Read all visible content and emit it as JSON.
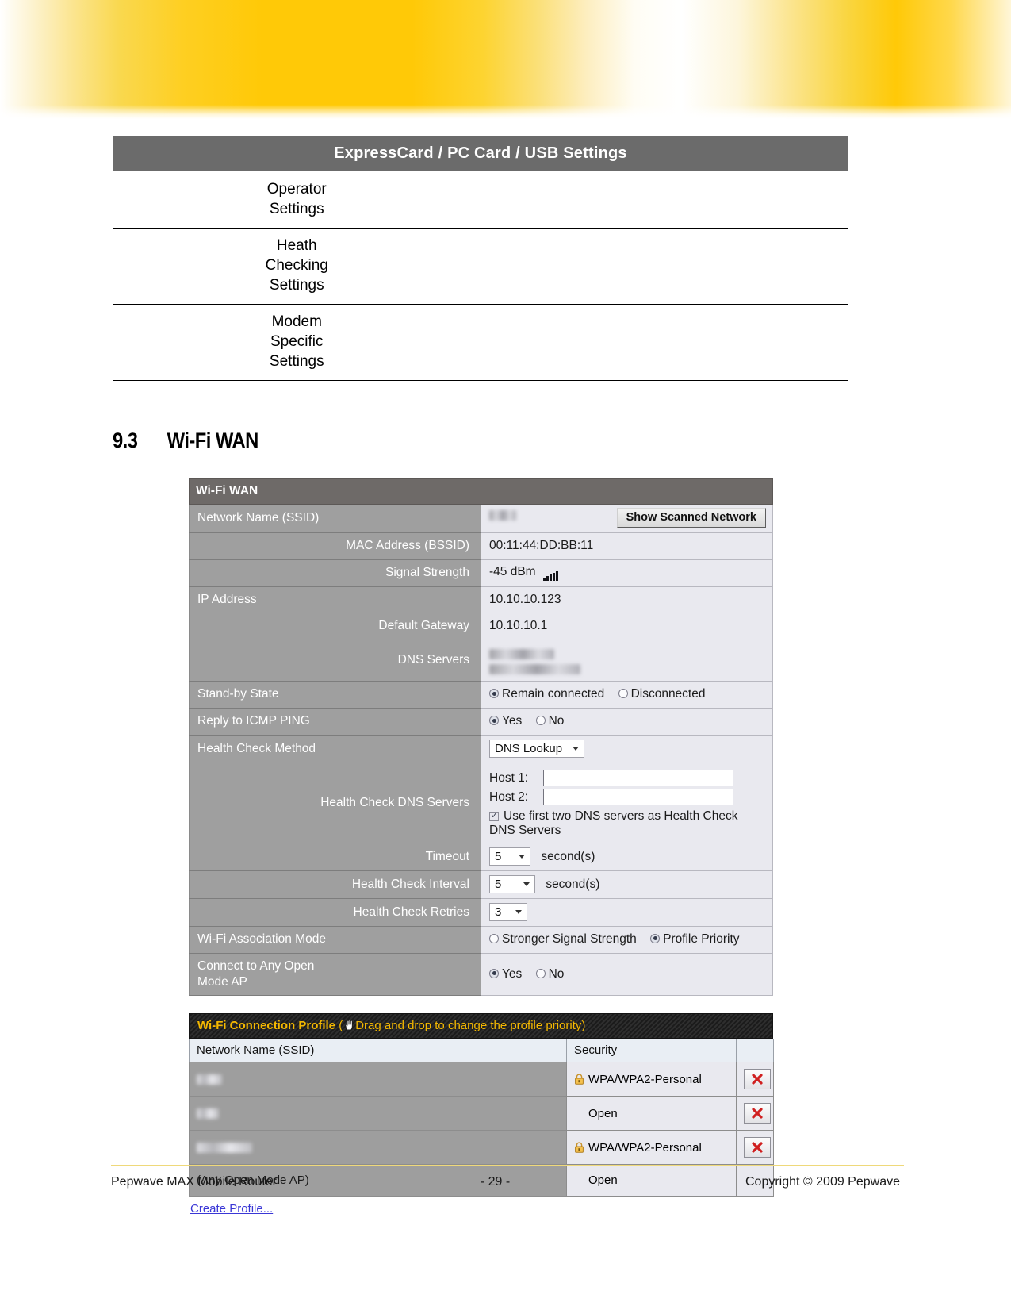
{
  "ec_table": {
    "header": "ExpressCard /  PC Card /  USB Settings",
    "rows": [
      {
        "label_lines": [
          "Operator",
          "Settings"
        ],
        "value": ""
      },
      {
        "label_lines": [
          "Heath",
          "Checking",
          "Settings"
        ],
        "value": ""
      },
      {
        "label_lines": [
          "Modem",
          "Specific",
          "Settings"
        ],
        "value": ""
      }
    ]
  },
  "section": {
    "number": "9.3",
    "title": "Wi-Fi WAN"
  },
  "wifi_wan": {
    "title": "Wi-Fi WAN",
    "rows": {
      "ssid": {
        "label": "Network Name (SSID)",
        "value": "",
        "button": "Show Scanned Network"
      },
      "bssid": {
        "label": "MAC Address (BSSID)",
        "value": "00:11:44:DD:BB:11"
      },
      "signal": {
        "label": "Signal Strength",
        "value": "-45 dBm"
      },
      "ip": {
        "label": "IP Address",
        "value": "10.10.10.123"
      },
      "gateway": {
        "label": "Default Gateway",
        "value": "10.10.10.1"
      },
      "dns": {
        "label": "DNS Servers",
        "value": ""
      },
      "standby": {
        "label": "Stand-by State",
        "options": [
          "Remain connected",
          "Disconnected"
        ],
        "selected": "Remain connected"
      },
      "icmp": {
        "label": "Reply to ICMP PING",
        "options": [
          "Yes",
          "No"
        ],
        "selected": "Yes"
      },
      "hc_method": {
        "label": "Health Check Method",
        "value": "DNS Lookup"
      },
      "hc_dns": {
        "label": "Health Check DNS Servers",
        "host1_label": "Host 1:",
        "host1_value": "",
        "host2_label": "Host 2:",
        "host2_value": "",
        "checkbox_label": "Use first two DNS servers as Health Check DNS Servers",
        "checkbox_checked": "true"
      },
      "timeout": {
        "label": "Timeout",
        "value": "5",
        "unit": "second(s)"
      },
      "hc_interval": {
        "label": "Health Check Interval",
        "value": "5",
        "unit": "second(s)"
      },
      "hc_retries": {
        "label": "Health Check Retries",
        "value": "3"
      },
      "assoc_mode": {
        "label": "Wi-Fi Association Mode",
        "options": [
          "Stronger Signal Strength",
          "Profile Priority"
        ],
        "selected": "Profile Priority"
      },
      "open_ap": {
        "label": "Connect to Any Open Mode AP",
        "label_line1": "Connect to Any Open",
        "label_line2": "Mode AP",
        "options": [
          "Yes",
          "No"
        ],
        "selected": "Yes"
      }
    }
  },
  "profile_panel": {
    "title_bold": "Wi-Fi Connection Profile",
    "title_rest": "(",
    "title_hint": "Drag and drop to change the profile priority)",
    "columns": [
      "Network Name (SSID)",
      "Security",
      ""
    ],
    "rows": [
      {
        "ssid": "",
        "ssid_redacted": "true",
        "security": "WPA/WPA2-Personal",
        "has_lock": "true",
        "has_delete": "true"
      },
      {
        "ssid": "",
        "ssid_redacted": "true",
        "security": "Open",
        "has_lock": "false",
        "has_delete": "true"
      },
      {
        "ssid": "",
        "ssid_redacted": "true",
        "security": "WPA/WPA2-Personal",
        "has_lock": "true",
        "has_delete": "true"
      },
      {
        "ssid": "(Any Open Mode AP)",
        "ssid_redacted": "false",
        "security": "Open",
        "has_lock": "false",
        "has_delete": "false"
      }
    ],
    "create_link": "Create Profile..."
  },
  "footer": {
    "left": "Pepwave MAX Mobile Router",
    "center": "- 29 -",
    "right": "Copyright © 2009 Pepwave"
  }
}
